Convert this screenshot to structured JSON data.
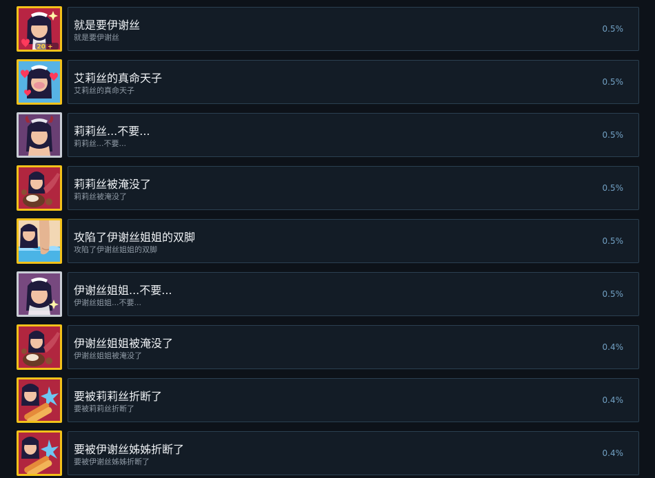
{
  "achievements": [
    {
      "title": "就是要伊谢丝",
      "description": "就是要伊谢丝",
      "percent": "0.5%",
      "icon": "maid-girl-hearts-20-icon",
      "badge": "20 +"
    },
    {
      "title": "艾莉丝的真命天子",
      "description": "艾莉丝的真命天子",
      "percent": "0.5%",
      "icon": "maid-girl-blush-hearts-icon",
      "badge": ""
    },
    {
      "title": "莉莉丝...不要...",
      "description": "莉莉丝...不要...",
      "percent": "0.5%",
      "icon": "devil-horn-girl-icon",
      "badge": ""
    },
    {
      "title": "莉莉丝被淹没了",
      "description": "莉莉丝被淹没了",
      "percent": "0.5%",
      "icon": "girl-chocolate-tentacle-icon",
      "badge": ""
    },
    {
      "title": "攻陷了伊谢丝姐姐的双脚",
      "description": "攻陷了伊谢丝姐姐的双脚",
      "percent": "0.5%",
      "icon": "girl-feet-water-icon",
      "badge": ""
    },
    {
      "title": "伊谢丝姐姐...不要...",
      "description": "伊谢丝姐姐...不要...",
      "percent": "0.5%",
      "icon": "maid-girl-sparkle-icon",
      "badge": ""
    },
    {
      "title": "伊谢丝姐姐被淹没了",
      "description": "伊谢丝姐姐被淹没了",
      "percent": "0.4%",
      "icon": "girl-chocolate-tentacle-icon",
      "badge": ""
    },
    {
      "title": "要被莉莉丝折断了",
      "description": "要被莉莉丝折断了",
      "percent": "0.4%",
      "icon": "girl-snapped-stick-icon",
      "badge": ""
    },
    {
      "title": "要被伊谢丝姊姊折断了",
      "description": "要被伊谢丝姊姊折断了",
      "percent": "0.4%",
      "icon": "girl-snapped-stick-icon",
      "badge": ""
    }
  ],
  "colors": {
    "background": "#0d1219",
    "card": "#131c26",
    "card_border": "#2b4051",
    "gold_frame": "#f3c21a",
    "silver_frame": "#c9ced6",
    "percent_text": "#72a1c4"
  }
}
